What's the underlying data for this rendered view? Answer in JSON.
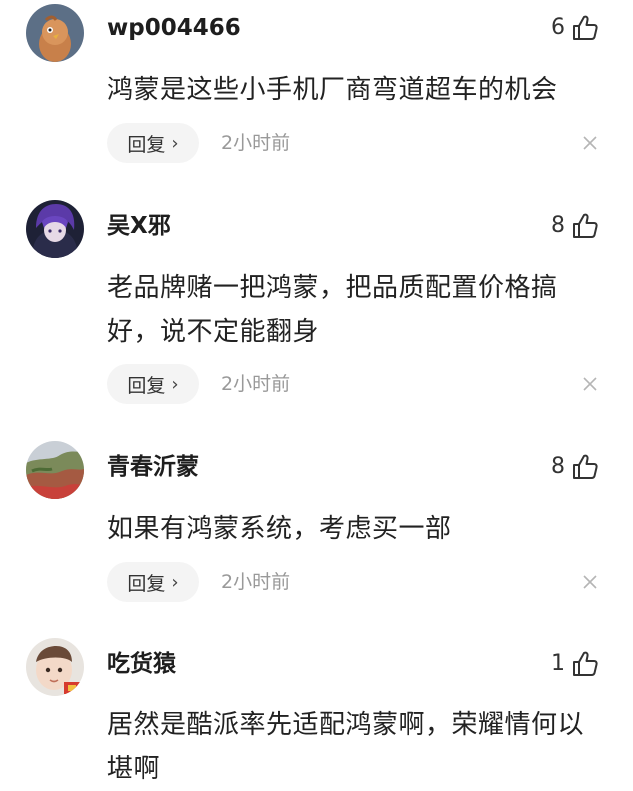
{
  "comments": [
    {
      "username": "wp004466",
      "likes": "6",
      "text": "鸿蒙是这些小手机厂商弯道超车的机会",
      "reply_label": "回复",
      "time": "2小时前"
    },
    {
      "username": "吴X邪",
      "likes": "8",
      "text": "老品牌赌一把鸿蒙，把品质配置价格搞好，说不定能翻身",
      "reply_label": "回复",
      "time": "2小时前"
    },
    {
      "username": "青春沂蒙",
      "likes": "8",
      "text": "如果有鸿蒙系统，考虑买一部",
      "reply_label": "回复",
      "time": "2小时前"
    },
    {
      "username": "吃货猿",
      "likes": "1",
      "text": "居然是酷派率先适配鸿蒙啊，荣耀情何以堪啊",
      "reply_label": "",
      "time": ""
    }
  ],
  "icons": {
    "like": "thumbs-up-icon",
    "close": "close-icon",
    "chevron": "chevron-right-icon"
  },
  "colors": {
    "text": "#222222",
    "meta": "#999999",
    "reply_bg": "#f4f4f4"
  }
}
